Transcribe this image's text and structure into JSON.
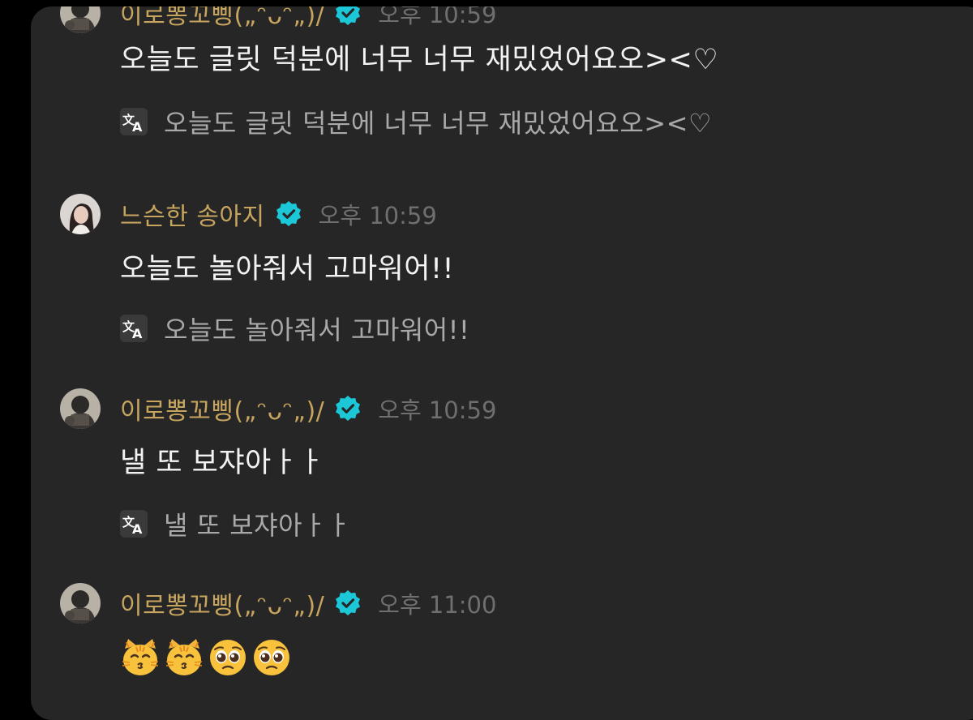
{
  "messages": [
    {
      "sender": "이로뽕꼬삥(„ᵔᴗᵔ„)/",
      "time": "오후 10:59",
      "text": "오늘도 글릿 덕분에 너무 너무 재밌었어요오><♡",
      "translation": "오늘도 글릿 덕분에 너무 너무 재밌었어요오><♡",
      "avatar": "avatar-dark"
    },
    {
      "sender": "느슨한 송아지",
      "time": "오후 10:59",
      "text": "오늘도 놀아줘서 고마워어!!",
      "translation": "오늘도 놀아줘서 고마워어!!",
      "avatar": "avatar-girl"
    },
    {
      "sender": "이로뽕꼬삥(„ᵔᴗᵔ„)/",
      "time": "오후 10:59",
      "text": "낼 또 보쟈아ㅏㅏ",
      "translation": "낼 또 보쟈아ㅏㅏ",
      "avatar": "avatar-dark"
    },
    {
      "sender": "이로뽕꼬삥(„ᵔᴗᵔ„)/",
      "time": "오후 11:00",
      "emojis": [
        "kissing-cat-emoji",
        "kissing-cat-emoji",
        "pleading-face-emoji",
        "pleading-face-emoji"
      ],
      "avatar": "avatar-dark"
    }
  ],
  "icons": {
    "verified": "verified-badge-icon",
    "translate": "translate-icon"
  },
  "colors": {
    "background": "#000000",
    "panel": "#262626",
    "sender_name": "#c7a55f",
    "timestamp": "#6f6f6f",
    "message_text": "#f3f3f3",
    "translation_text": "#a9a9a9",
    "verified": "#1cc8d8"
  }
}
